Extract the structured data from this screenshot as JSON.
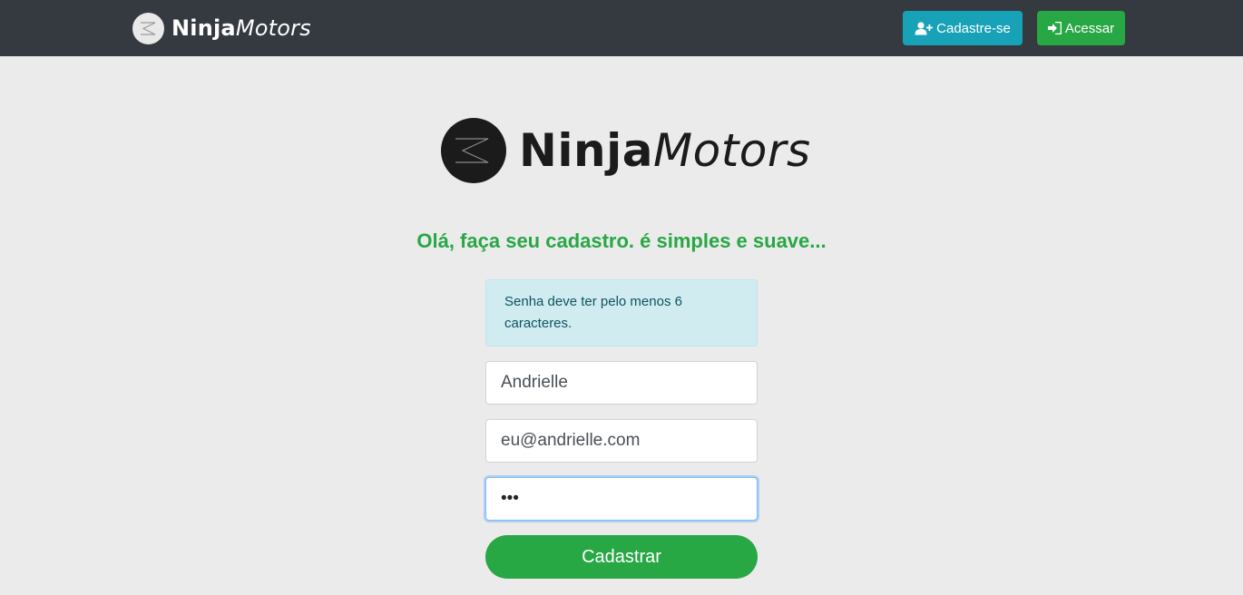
{
  "navbar": {
    "brand_bold": "Ninja",
    "brand_italic": "Motors",
    "signup_label": "Cadastre-se",
    "login_label": "Acessar",
    "colors": {
      "background": "#343a40",
      "signup": "#17a2b8",
      "login": "#28a745"
    }
  },
  "logo": {
    "bold": "Ninja",
    "italic": "Motors"
  },
  "headline": "Olá, faça seu cadastro. é simples e suave...",
  "alert": {
    "message": "Senha deve ter pelo menos 6 caracteres."
  },
  "form": {
    "name_value": "Andrielle",
    "email_value": "eu@andrielle.com",
    "password_value": "123",
    "submit_label": "Cadastrar"
  },
  "icons": [
    "ninja-logo-icon",
    "user-plus-icon",
    "sign-in-icon"
  ]
}
